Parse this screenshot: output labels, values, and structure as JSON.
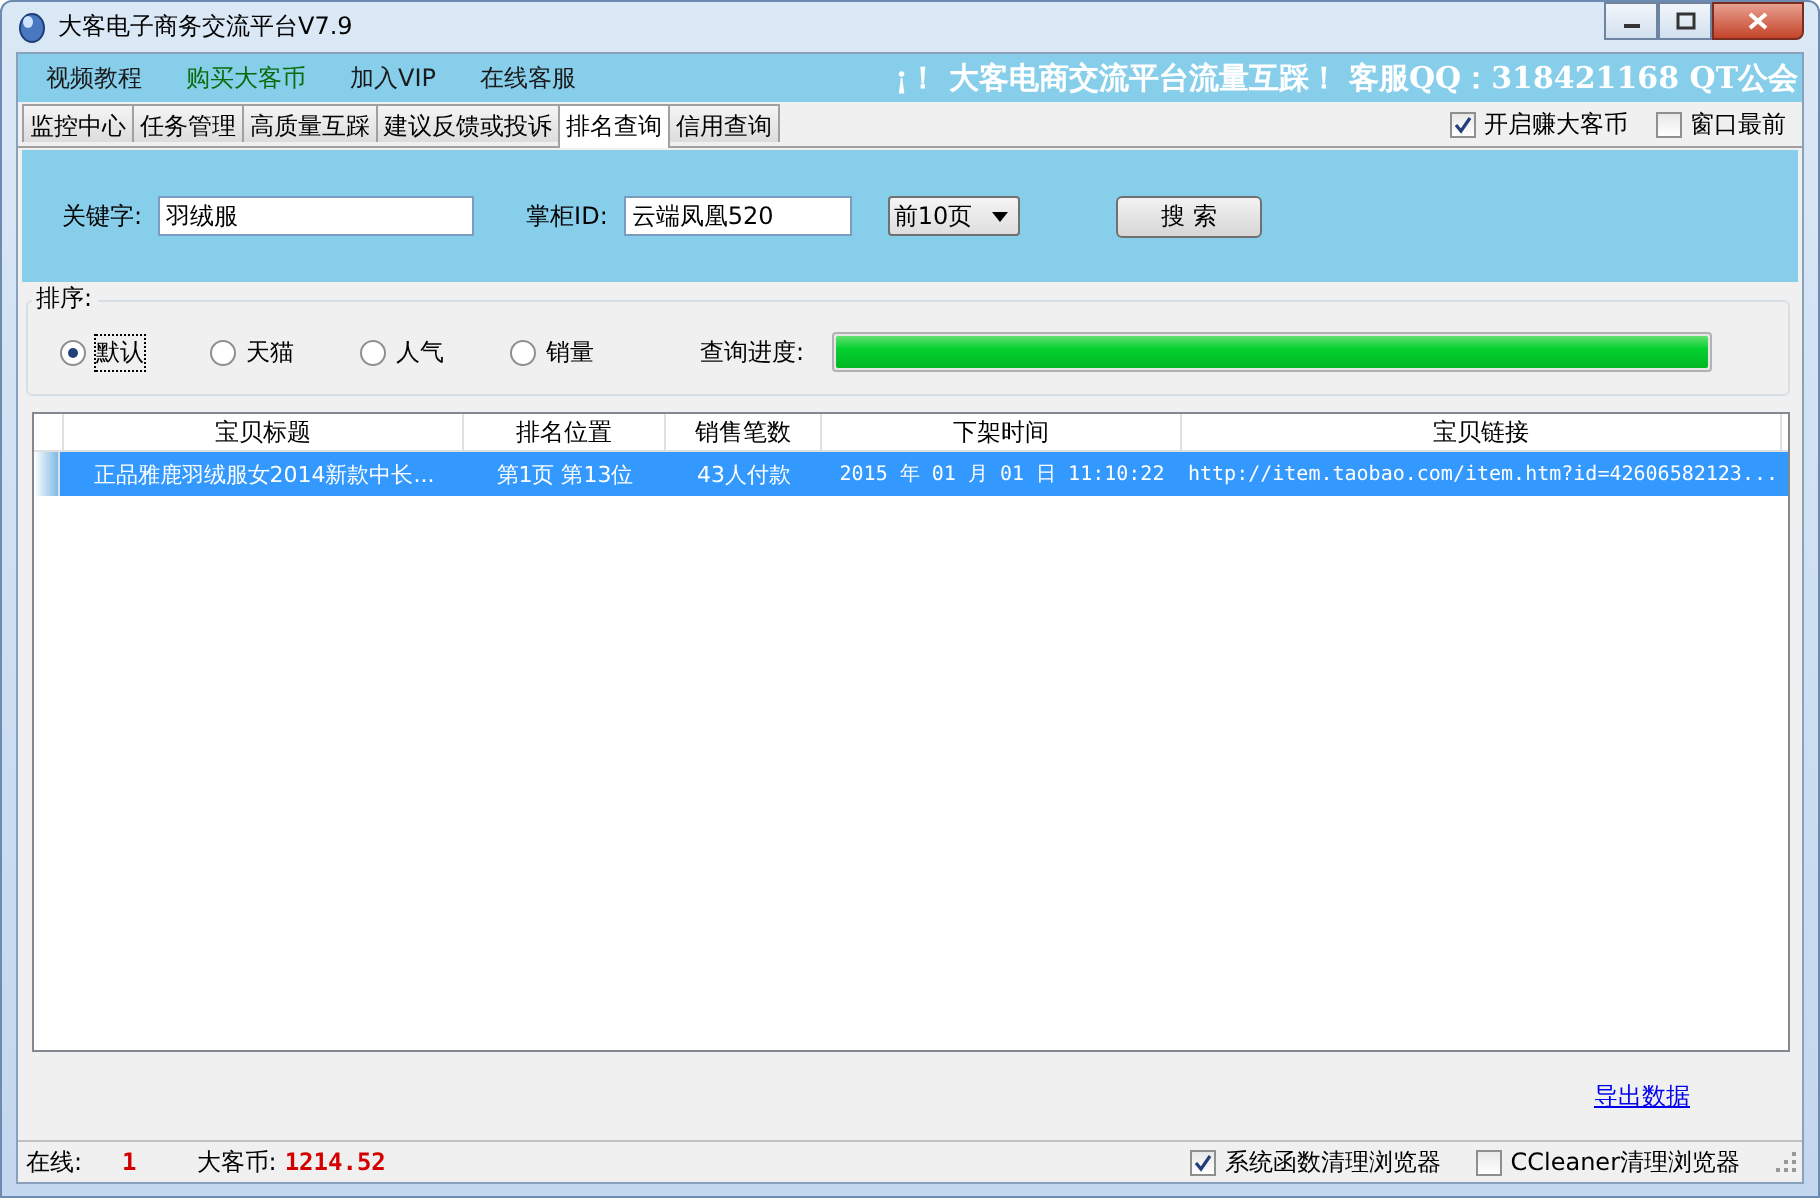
{
  "window": {
    "title": "大客电子商务交流平台V7.9"
  },
  "menu": {
    "items": [
      {
        "label": "视频教程",
        "color": "#1a1a1a"
      },
      {
        "label": "购买大客币",
        "color": "#0a6b0a"
      },
      {
        "label": "加入VIP",
        "color": "#1a1a1a"
      },
      {
        "label": "在线客服",
        "color": "#1a1a1a"
      }
    ],
    "marquee": "¡！ 大客电商交流平台流量互踩！  客服QQ：318421168  QT公会"
  },
  "tabs": [
    {
      "label": "监控中心",
      "selected": false
    },
    {
      "label": "任务管理",
      "selected": false
    },
    {
      "label": "高质量互踩",
      "selected": false
    },
    {
      "label": "建议反馈或投诉",
      "selected": false
    },
    {
      "label": "排名查询",
      "selected": true
    },
    {
      "label": "信用查询",
      "selected": false
    }
  ],
  "options": [
    {
      "label": "开启赚大客币",
      "checked": true
    },
    {
      "label": "窗口最前",
      "checked": false
    }
  ],
  "search": {
    "keyword_label": "关键字:",
    "keyword": "羽绒服",
    "shop_label": "掌柜ID:",
    "shop_id": "云端凤凰520",
    "pages": "前10页",
    "button": "搜 索"
  },
  "sort": {
    "label": "排序:",
    "options": [
      {
        "label": "默认",
        "selected": true
      },
      {
        "label": "天猫",
        "selected": false
      },
      {
        "label": "人气",
        "selected": false
      },
      {
        "label": "销量",
        "selected": false
      }
    ],
    "progress_label": "查询进度:",
    "level": 1
  },
  "table": {
    "columns": [
      "宝贝标题",
      "排名位置",
      "销售笔数",
      "下架时间",
      "宝贝链接"
    ],
    "rows": [
      {
        "selected": true,
        "cells": [
          "正品雅鹿羽绒服女2014新款中长...",
          "第1页 第13位",
          "43人付款",
          "2015 年 01 月 01 日 11:10:22",
          "http://item.taobao.com/item.htm?id=42606582123..."
        ]
      }
    ]
  },
  "export_link": "导出数据",
  "status_bar": {
    "online_label": "在线:",
    "online": "1",
    "coins_label": "大客币:",
    "coins": "1214.52",
    "options": [
      {
        "label": "系统函数清理浏览器",
        "checked": true
      },
      {
        "label": "CCleaner清理浏览器",
        "checked": false
      }
    ]
  }
}
